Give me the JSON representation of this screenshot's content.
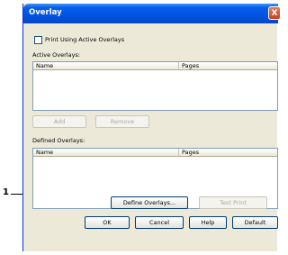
{
  "window": {
    "title": "Overlay",
    "close_label": "X"
  },
  "print_active": {
    "label": "Print Using Active Overlays",
    "checked": false
  },
  "active_overlays": {
    "label": "Active Overlays:",
    "columns": [
      "Name",
      "Pages"
    ],
    "rows": []
  },
  "active_buttons": {
    "add": "Add",
    "remove": "Remove"
  },
  "defined_overlays": {
    "label": "Defined Overlays:",
    "columns": [
      "Name",
      "Pages"
    ],
    "rows": []
  },
  "action_buttons": {
    "define": "Define Overlays...",
    "test_print": "Test Print"
  },
  "footer_buttons": {
    "ok": "OK",
    "cancel": "Cancel",
    "help": "Help",
    "default": "Default"
  },
  "callout": {
    "number": "1"
  }
}
